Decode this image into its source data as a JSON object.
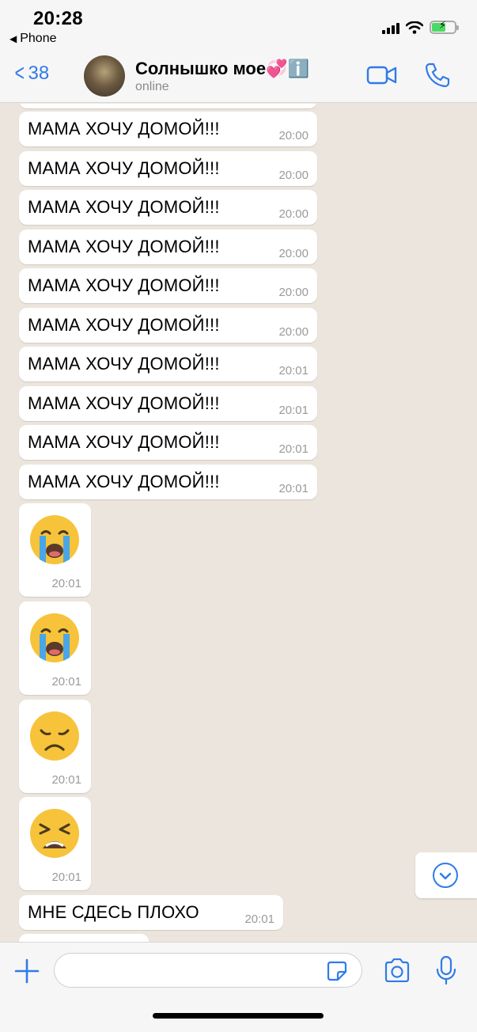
{
  "status_bar": {
    "time": "20:28",
    "back_app_label": "Phone"
  },
  "header": {
    "back_count": "38",
    "contact_name": "Солнышко мое💞ℹ️",
    "contact_status": "online"
  },
  "messages": [
    {
      "text": "МАМА ХОЧУ ДОМОЙ!!!",
      "time": "20:00"
    },
    {
      "text": "МАМА ХОЧУ ДОМОЙ!!!",
      "time": "20:00"
    },
    {
      "text": "МАМА ХОЧУ ДОМОЙ!!!",
      "time": "20:00"
    },
    {
      "text": "МАМА ХОЧУ ДОМОЙ!!!",
      "time": "20:00"
    },
    {
      "text": "МАМА ХОЧУ ДОМОЙ!!!",
      "time": "20:00"
    },
    {
      "text": "МАМА ХОЧУ ДОМОЙ!!!",
      "time": "20:00"
    },
    {
      "text": "МАМА ХОЧУ ДОМОЙ!!!",
      "time": "20:01"
    },
    {
      "text": "МАМА ХОЧУ ДОМОЙ!!!",
      "time": "20:01"
    },
    {
      "text": "МАМА ХОЧУ ДОМОЙ!!!",
      "time": "20:01"
    },
    {
      "text": "МАМА ХОЧУ ДОМОЙ!!!",
      "time": "20:01"
    }
  ],
  "emoji_messages": [
    {
      "emoji": "loudly-crying-face",
      "time": "20:01"
    },
    {
      "emoji": "loudly-crying-face",
      "time": "20:01"
    },
    {
      "emoji": "disappointed-face",
      "time": "20:01"
    },
    {
      "emoji": "tired-face",
      "time": "20:01"
    }
  ],
  "last_message": {
    "text": "МНЕ СДЕСЬ ПЛОХО",
    "time": "20:01"
  },
  "input": {
    "placeholder": ""
  },
  "colors": {
    "accent": "#2f7be8",
    "chat_background": "#ece5dd",
    "bubble": "#ffffff",
    "bar_background": "#f6f6f6"
  }
}
